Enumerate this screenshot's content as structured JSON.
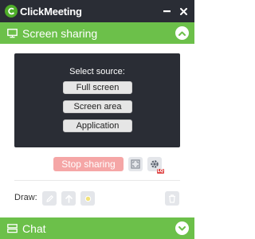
{
  "app": {
    "title": "ClickMeeting",
    "brand_color": "#6cc04a",
    "titlebar_color": "#2a2d35"
  },
  "window_controls": [
    "minimize-icon",
    "close-icon"
  ],
  "screen_sharing": {
    "label": "Screen sharing",
    "icon": "monitor-icon",
    "toggle_icon": "chevron-up-icon",
    "panel": {
      "title": "Select source:",
      "options": [
        "Full screen",
        "Screen area",
        "Application"
      ]
    },
    "stop_label": "Stop sharing",
    "stop_color": "#f5a6a6",
    "quality_badge": "LQ",
    "tools": [
      "fit-screen-icon",
      "quality-settings-icon"
    ]
  },
  "draw": {
    "label": "Draw:",
    "tools": [
      "pencil-icon",
      "pointer-arrow-icon",
      "highlight-dot-icon"
    ],
    "clear_icon": "trash-icon"
  },
  "chat": {
    "label": "Chat",
    "icon": "chat-icon",
    "toggle_icon": "chevron-down-icon"
  }
}
